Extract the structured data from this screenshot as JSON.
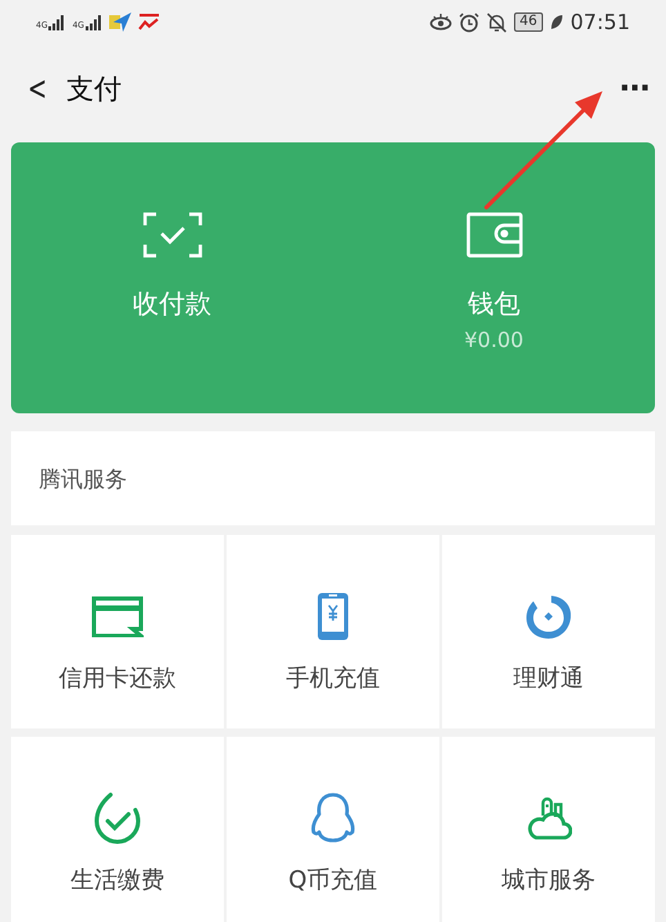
{
  "status_bar": {
    "signals": [
      "4G",
      "4G"
    ],
    "battery": "46",
    "time": "07:51"
  },
  "header": {
    "back": "<",
    "title": "支付",
    "more": "···"
  },
  "pay_card": {
    "actions": [
      {
        "kind": "scan",
        "label": "收付款"
      },
      {
        "kind": "wallet",
        "label": "钱包",
        "amount": "¥0.00"
      }
    ]
  },
  "services": {
    "title": "腾讯服务",
    "items": [
      {
        "kind": "card",
        "label": "信用卡还款"
      },
      {
        "kind": "phone",
        "label": "手机充值"
      },
      {
        "kind": "fund",
        "label": "理财通"
      },
      {
        "kind": "bill",
        "label": "生活缴费"
      },
      {
        "kind": "penguin",
        "label": "Q币充值"
      },
      {
        "kind": "city",
        "label": "城市服务"
      }
    ]
  }
}
